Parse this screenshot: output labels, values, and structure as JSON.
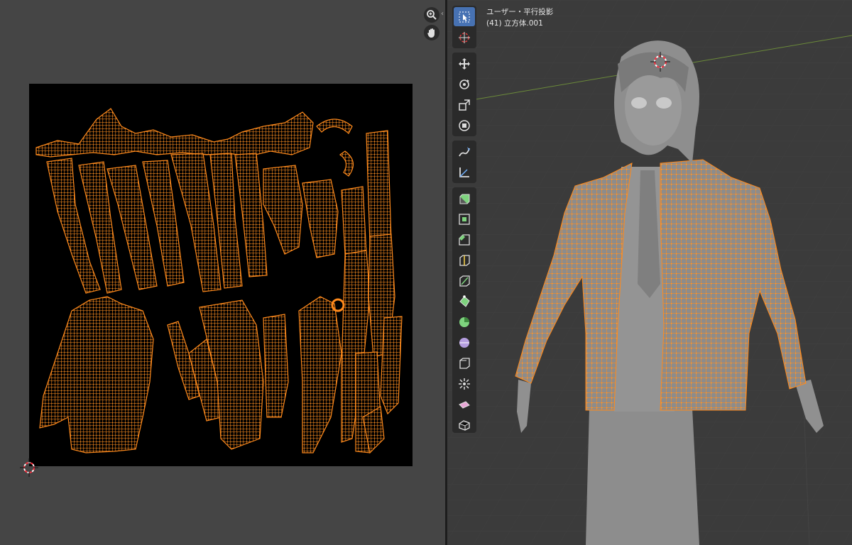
{
  "viewport": {
    "view_name": "ユーザー・平行投影",
    "object_info": "(41) 立方体.001"
  },
  "uv_editor": {
    "nav_icons": [
      "zoom-icon",
      "hand-pan-icon"
    ]
  },
  "toolbar": {
    "tools": [
      {
        "name": "select-box",
        "icon": "select-box-icon",
        "active": true
      },
      {
        "name": "cursor",
        "icon": "cursor-icon",
        "active": false
      },
      {
        "name": "move",
        "icon": "move-icon",
        "active": false
      },
      {
        "name": "rotate",
        "icon": "rotate-icon",
        "active": false
      },
      {
        "name": "scale",
        "icon": "scale-icon",
        "active": false
      },
      {
        "name": "transform",
        "icon": "transform-icon",
        "active": false
      },
      {
        "name": "annotate",
        "icon": "annotate-icon",
        "active": false
      },
      {
        "name": "measure",
        "icon": "measure-icon",
        "active": false
      },
      {
        "name": "extrude",
        "icon": "extrude-icon",
        "active": false
      },
      {
        "name": "inset",
        "icon": "inset-icon",
        "active": false
      },
      {
        "name": "bevel",
        "icon": "bevel-icon",
        "active": false
      },
      {
        "name": "loop-cut",
        "icon": "loop-cut-icon",
        "active": false
      },
      {
        "name": "knife",
        "icon": "knife-icon",
        "active": false
      },
      {
        "name": "poly-build",
        "icon": "poly-build-icon",
        "active": false
      },
      {
        "name": "spin",
        "icon": "spin-icon",
        "active": false
      },
      {
        "name": "smooth",
        "icon": "smooth-icon",
        "active": false
      },
      {
        "name": "edge-slide",
        "icon": "edge-slide-icon",
        "active": false
      },
      {
        "name": "shrink-fatten",
        "icon": "shrink-fatten-icon",
        "active": false
      },
      {
        "name": "shear",
        "icon": "shear-icon",
        "active": false
      },
      {
        "name": "rip",
        "icon": "rip-icon",
        "active": false
      }
    ]
  },
  "colors": {
    "selection_orange": "#ff8a1c",
    "active_tool_blue": "#4772b3",
    "uv_background": "#000000",
    "panel_gray": "#454545",
    "viewport_gray": "#3b3b3b"
  }
}
